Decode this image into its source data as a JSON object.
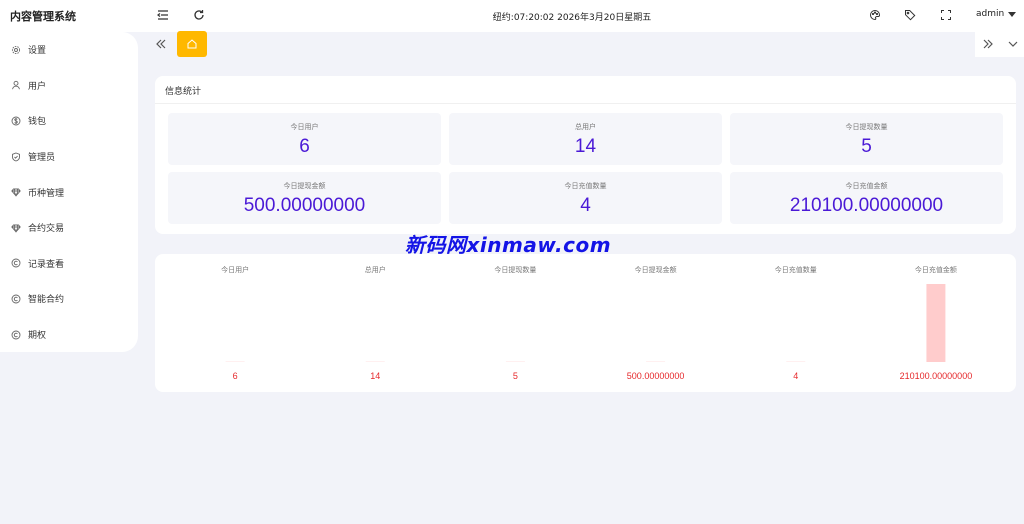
{
  "header": {
    "app_title": "内容管理系统",
    "clock": "纽约:07:20:02 2026年3月20日星期五",
    "user": "admin",
    "icons": [
      "menu-fold-icon",
      "refresh-icon",
      "theme-icon",
      "tag-icon",
      "fullscreen-icon"
    ]
  },
  "sidebar": {
    "items": [
      {
        "label": "设置",
        "icon": "gear-icon"
      },
      {
        "label": "用户",
        "icon": "user-icon"
      },
      {
        "label": "钱包",
        "icon": "dollar-icon"
      },
      {
        "label": "管理员",
        "icon": "shield-icon"
      },
      {
        "label": "币种管理",
        "icon": "diamond-icon"
      },
      {
        "label": "合约交易",
        "icon": "diamond-icon"
      },
      {
        "label": "记录查看",
        "icon": "copyright-icon"
      },
      {
        "label": "智能合约",
        "icon": "copyright-icon"
      },
      {
        "label": "期权",
        "icon": "copyright-icon"
      }
    ]
  },
  "tabs": {
    "home_icon": "home-icon",
    "accent": "#ffb800"
  },
  "stats": {
    "title": "信息统计",
    "items": [
      {
        "label": "今日用户",
        "value": "6"
      },
      {
        "label": "总用户",
        "value": "14"
      },
      {
        "label": "今日提现数量",
        "value": "5"
      },
      {
        "label": "今日提现金额",
        "value": "500.00000000"
      },
      {
        "label": "今日充值数量",
        "value": "4"
      },
      {
        "label": "今日充值金额",
        "value": "210100.00000000"
      }
    ],
    "value_color": "#4a19d6"
  },
  "chart_data": {
    "type": "bar",
    "categories": [
      "今日用户",
      "总用户",
      "今日提现数量",
      "今日提现金额",
      "今日充值数量",
      "今日充值金额"
    ],
    "values": [
      6,
      14,
      5,
      500,
      4,
      210100
    ],
    "labels": [
      "6",
      "14",
      "5",
      "500.00000000",
      "4",
      "210100.00000000"
    ],
    "ylim": [
      0,
      210100
    ],
    "bar_color": "#ffcccc",
    "label_color": "#e6282b",
    "grid": false
  },
  "watermark": "新码网xinmaw.com"
}
